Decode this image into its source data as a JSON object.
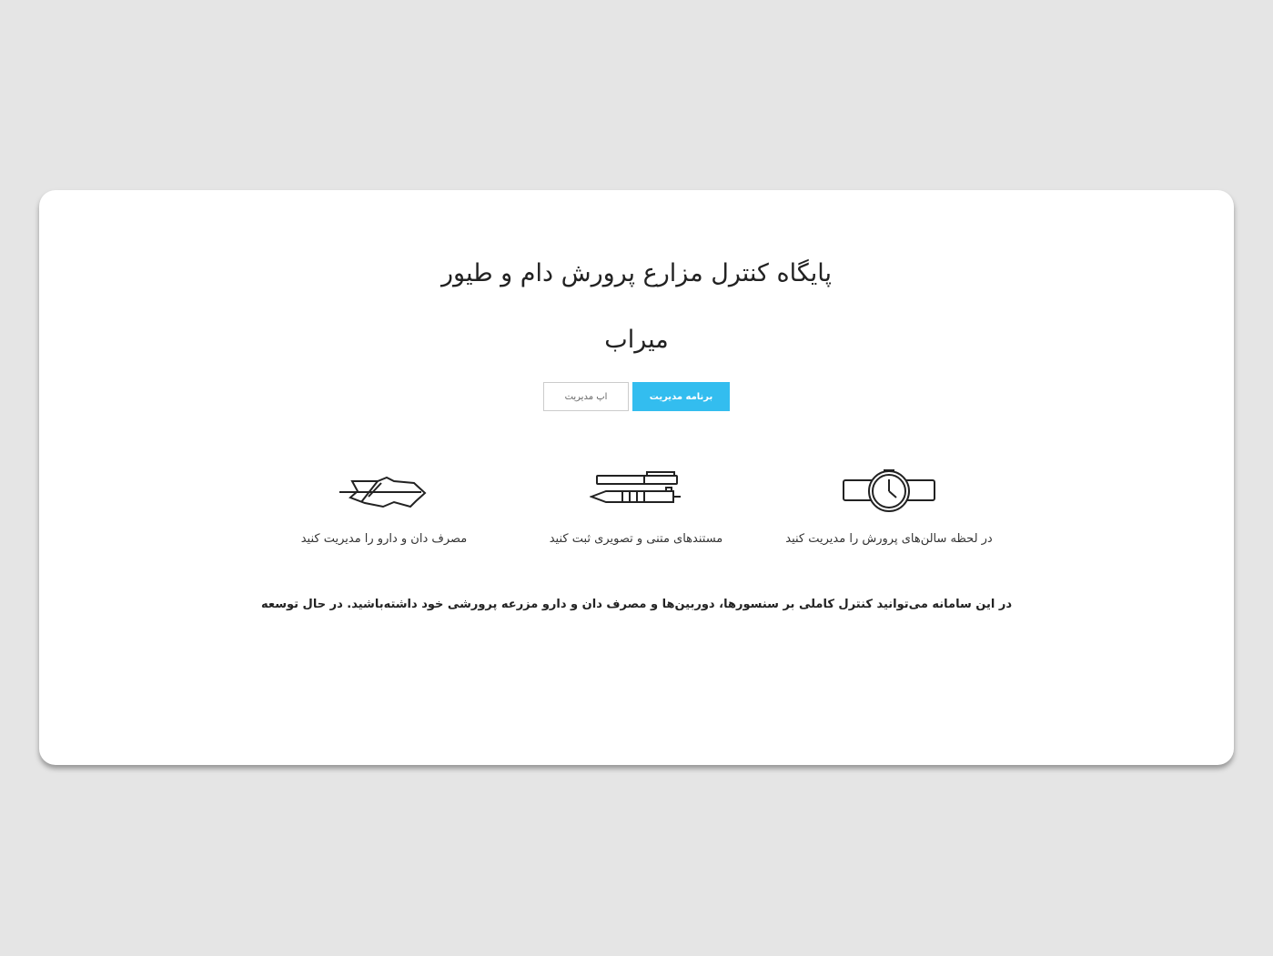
{
  "hero": {
    "title": "پایگاه کنترل مزارع پرورش دام و طیور",
    "subtitle": "میراب"
  },
  "buttons": {
    "primary_label": "برنامه مدیریت",
    "secondary_label": "اپ مدیریت"
  },
  "features": [
    {
      "icon": "watch-icon",
      "label": "در لحظه سالن‌های پرورش را مدیریت کنید"
    },
    {
      "icon": "pen-pencil-icon",
      "label": "مستندهای متنی و تصویری ثبت کنید"
    },
    {
      "icon": "feather-icon",
      "label": "مصرف دان و دارو را مدیریت کنید"
    }
  ],
  "footer": {
    "text": "در این سامانه می‌توانید کنترل کاملی بر سنسورها، دوربین‌ها و مصرف دان و دارو مزرعه پرورشی خود داشته‌باشید. در حال توسعه"
  },
  "colors": {
    "page_background": "#e5e5e5",
    "card_background": "#ffffff",
    "primary_button": "#33bdef"
  }
}
